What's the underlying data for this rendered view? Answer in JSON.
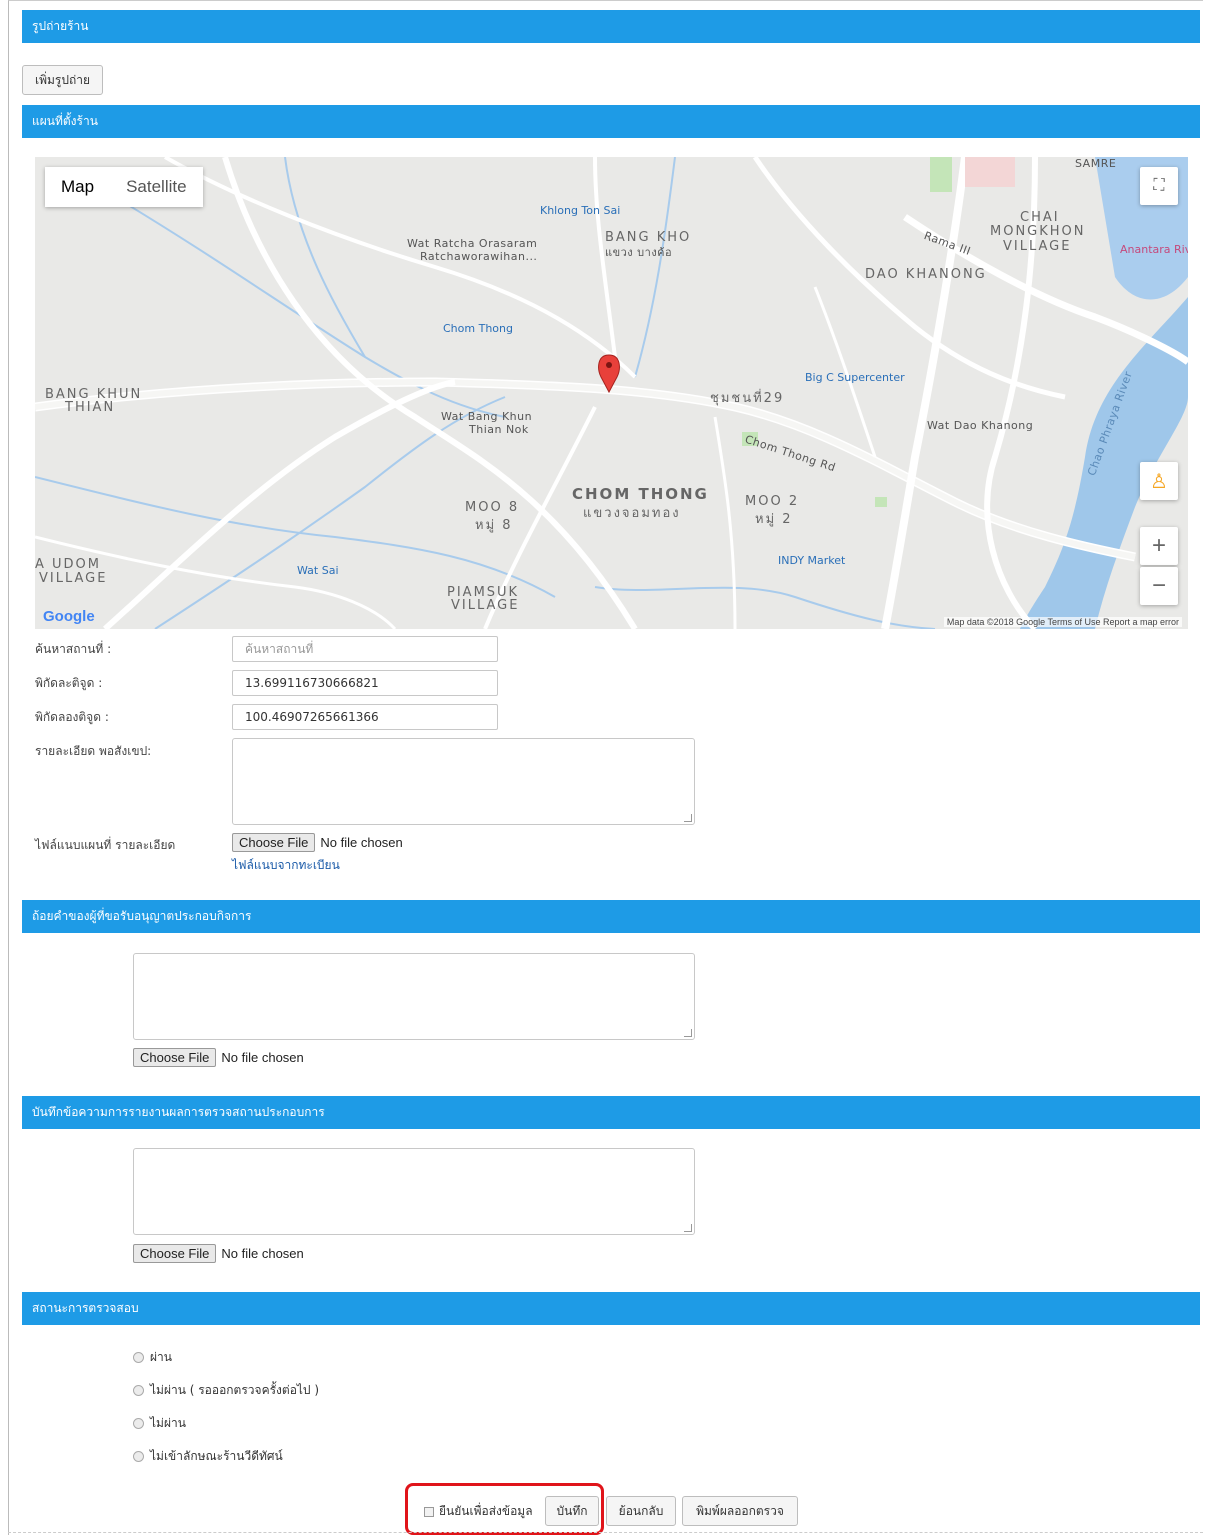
{
  "sections": {
    "photos_title": "รูปถ่ายร้าน",
    "map_title": "แผนที่ตั้งร้าน",
    "statement_title": "ถ้อยคำของผู้ที่ขอรับอนุญาตประกอบกิจการ",
    "report_title": "บันทึกข้อความการรายงานผลการตรวจสถานประกอบการ",
    "status_title": "สถานะการตรวจสอบ"
  },
  "photos": {
    "add_button": "เพิ่มรูปถ่าย"
  },
  "map": {
    "type_map": "Map",
    "type_satellite": "Satellite",
    "zoom_in": "+",
    "zoom_out": "−",
    "logo": "Google",
    "footer": "Map data ©2018 Google   Terms of Use   Report a map error",
    "labels": {
      "bang_kho": "BANG KHO",
      "bang_kho_th": "แขวง บางค้อ",
      "chai_mongkhon": "CHAI",
      "chai_mongkhon2": "MONGKHON",
      "chai_mongkhon3": "VILLAGE",
      "dao_khanong": "DAO KHANONG",
      "bang_khun_thian": "BANG KHUN",
      "bang_khun_thian2": "THIAN",
      "chom_thong": "CHOM THONG",
      "chom_thong_th": "แขวงจอมทอง",
      "moo8": "MOO 8",
      "moo8_th": "หมู่ 8",
      "moo2": "MOO 2",
      "moo2_th": "หมู่ 2",
      "piamsuk": "PIAMSUK",
      "piamsuk2": "VILLAGE",
      "udom": "A UDOM",
      "udom2": "VILLAGE",
      "chumchon": "ชุมชนที่29",
      "khlong_ton_sai": "Khlong Ton Sai",
      "wat_ratcha": "Wat Ratcha Orasaram",
      "wat_ratcha2": "Ratchaworawihan...",
      "chom_thong_poi": "Chom Thong",
      "wat_bang_khun": "Wat Bang Khun",
      "wat_bang_khun2": "Thian Nok",
      "big_c": "Big C Supercenter",
      "wat_dao": "Wat Dao Khanong",
      "indy": "INDY Market",
      "wat_sai": "Wat Sai",
      "anantara": "Anantara Riv",
      "samre": "SAMRE",
      "chom_thong_rd": "Chom Thong Rd",
      "rama3": "Rama III",
      "chao_phraya": "Chao Phraya River"
    }
  },
  "form": {
    "search_label": "ค้นหาสถานที่ :",
    "search_placeholder": "ค้นหาสถานที่",
    "lat_label": "พิกัดละติจูด :",
    "lat_value": "13.699116730666821",
    "lng_label": "พิกัดลองติจูด :",
    "lng_value": "100.46907265661366",
    "detail_label": "รายละเอียด พอสังเขป:",
    "attach_label": "ไฟล์แนบแผนที่ รายละเอียด",
    "choose_file": "Choose File",
    "no_file": "No file chosen",
    "attach_link": "ไฟล์แนบจากทะเบียน"
  },
  "status": {
    "options": [
      "ผ่าน",
      "ไม่ผ่าน ( รอออกตรวจครั้งต่อไป )",
      "ไม่ผ่าน",
      "ไม่เข้าลักษณะร้านวีดีทัศน์"
    ]
  },
  "footer": {
    "confirm_label": "ยืนยันเพื่อส่งข้อมูล",
    "save_button": "บันทึก",
    "back_button": "ย้อนกลับ",
    "print_button": "พิมพ์ผลออกตรวจ"
  }
}
